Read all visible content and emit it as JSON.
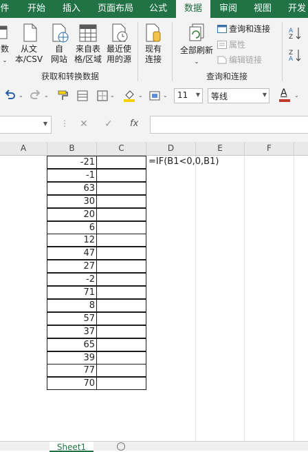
{
  "colors": {
    "ribbon_green": "#217346",
    "font_color_bar": "#c0392b",
    "highlight_bar": "#f5d000"
  },
  "tabs": [
    "件",
    "开始",
    "插入",
    "页面布局",
    "公式",
    "数据",
    "审阅",
    "视图",
    "开发"
  ],
  "active_tab": "数据",
  "ribbon": {
    "get_data_label": "数",
    "from_text_label_1": "从文",
    "from_text_label_2": "本/CSV",
    "from_web_label_1": "自",
    "from_web_label_2": "网站",
    "from_table_label_1": "来自表",
    "from_table_label_2": "格/区域",
    "recent_label_1": "最近使",
    "recent_label_2": "用的源",
    "existing_label_1": "现有",
    "existing_label_2": "连接",
    "group1_label": "获取和转换数据",
    "refresh_all_label": "全部刷新",
    "queries_label": "查询和连接",
    "properties_label": "属性",
    "edit_links_label": "编辑链接",
    "group2_label": "查询和连接"
  },
  "toolbar": {
    "font_size": "11",
    "font_name": "等线",
    "font_color_letter": "A"
  },
  "formula_bar": {
    "fx": "fx",
    "cancel": "✕",
    "confirm": "✓"
  },
  "columns": [
    "A",
    "B",
    "C",
    "D",
    "E",
    "F"
  ],
  "cells": {
    "B": [
      "-21",
      "-1",
      "63",
      "30",
      "20",
      "6",
      "12",
      "47",
      "27",
      "-2",
      "71",
      "8",
      "57",
      "37",
      "65",
      "39",
      "77",
      "70"
    ],
    "D1": "=IF(B1<0,0,B1)"
  },
  "sheet_tab": "Sheet1",
  "add_sheet": "+"
}
